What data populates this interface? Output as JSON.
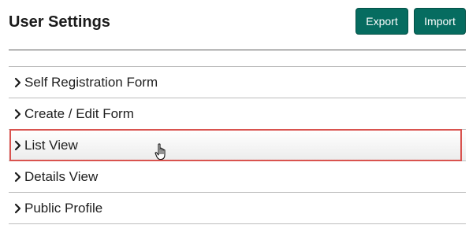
{
  "header": {
    "title": "User Settings",
    "export_label": "Export",
    "import_label": "Import"
  },
  "menu": {
    "items": [
      {
        "label": "Self Registration Form"
      },
      {
        "label": "Create / Edit Form"
      },
      {
        "label": "List View"
      },
      {
        "label": "Details View"
      },
      {
        "label": "Public Profile"
      }
    ]
  },
  "colors": {
    "button_bg": "#066c60",
    "highlight_border": "#d9534f"
  },
  "icons": {
    "chevron": "chevron-right-icon",
    "cursor": "hand-pointer-cursor-icon"
  }
}
